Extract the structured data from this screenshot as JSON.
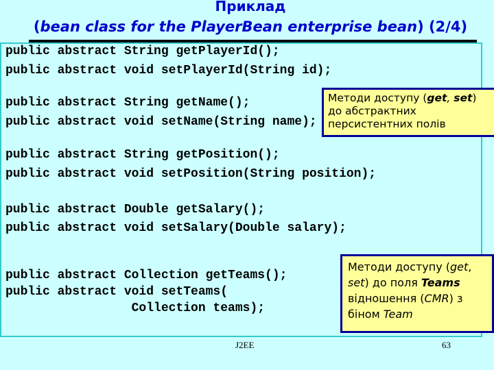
{
  "slide": {
    "title": "Приклад",
    "subtitle": {
      "open_paren": "(",
      "italic_text": "bean class for the PlayerBean enterprise bean",
      "close_paren": ")",
      "part": " (2/4)"
    }
  },
  "code": {
    "lines": [
      "public abstract String getPlayerId();",
      "public abstract void setPlayerId(String id);",
      "public abstract String getName();",
      "public abstract void setName(String name);",
      "public abstract String getPosition();",
      "public abstract void setPosition(String position);",
      "public abstract Double getSalary();",
      "public abstract void setSalary(Double salary);",
      "public abstract Collection getTeams();",
      "public abstract void setTeams(",
      "                 Collection teams);"
    ]
  },
  "callouts": {
    "persistent_fields": {
      "text_1": "Методи доступу (",
      "get": "get",
      "comma": ", ",
      "set": "set",
      "text_2": ")",
      "text_3": "до абстрактних",
      "text_4": "персистентних полів"
    },
    "cmr_field": {
      "text_1": "Методи доступу (",
      "get": "get",
      "comma": ",",
      "set": "set",
      "text_2": ") до поля ",
      "teams": "Teams",
      "text_3": "відношення (",
      "cmr": "CMR",
      "text_4": ") з",
      "text_5": "біном ",
      "team": "Team"
    }
  },
  "footer": {
    "center": "J2EE",
    "page_number": "63"
  },
  "colors": {
    "background": "#ccffff",
    "title": "#0000cc",
    "callout_fill": "#ffff99",
    "callout_border": "#000099",
    "box_border": "#33cccc"
  }
}
